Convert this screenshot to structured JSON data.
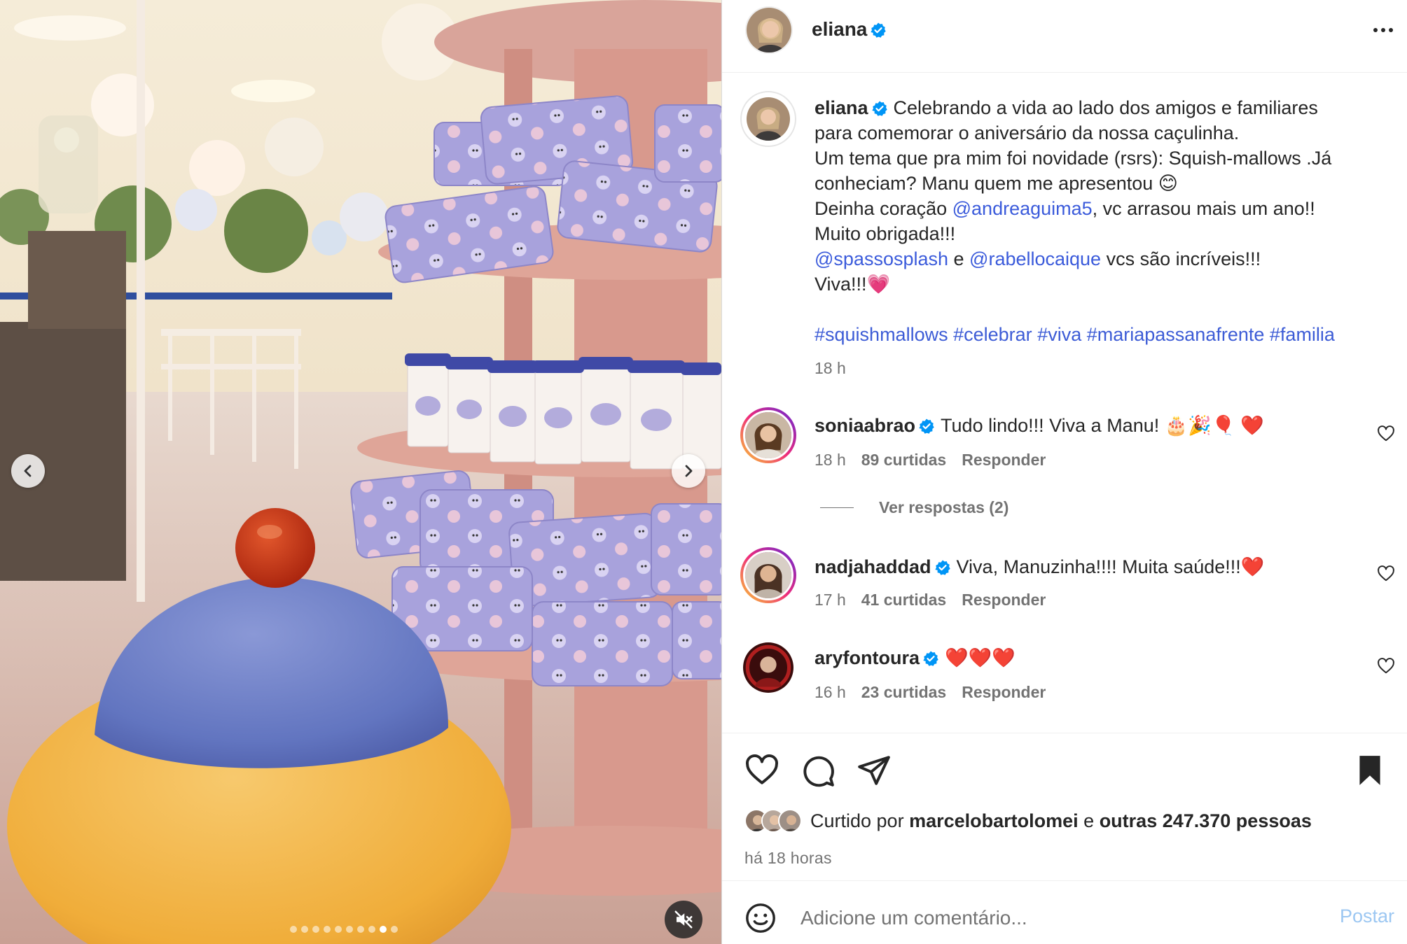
{
  "post": {
    "username": "eliana",
    "verified": true,
    "media": {
      "slide_count": 10,
      "active_slide": 9
    }
  },
  "caption": {
    "username": "eliana",
    "line1": "Celebrando a vida ao lado dos amigos e familiares",
    "line2": "para comemorar o aniversário da nossa caçulinha.",
    "line3": "Um tema que pra mim foi novidade (rsrs): Squish-mallows .Já",
    "line4": "conheciam? Manu quem me apresentou 😊",
    "line5_pre": "Deinha coração ",
    "line5_mention": "@andreaguima5",
    "line5_post": ", vc arrasou mais um ano!!",
    "line6": "Muito obrigada!!!",
    "line7_mention1": "@spassosplash",
    "line7_mid": " e ",
    "line7_mention2": "@rabellocaique",
    "line7_post": " vcs são incríveis!!!",
    "line8": "Viva!!!💗",
    "hashtags": [
      "#squishmallows",
      "#celebrar",
      "#viva",
      "#mariapassanafrente",
      "#familia"
    ],
    "time": "18 h"
  },
  "comments": [
    {
      "username": "soniaabrao",
      "text": "Tudo lindo!!! Viva a Manu! 🎂🎉🎈 ❤️",
      "time": "18 h",
      "likes": "89 curtidas",
      "reply": "Responder"
    },
    {
      "username": "nadjahaddad",
      "text": "Viva, Manuzinha!!!! Muita saúde!!!❤️",
      "time": "17 h",
      "likes": "41 curtidas",
      "reply": "Responder"
    },
    {
      "username": "aryfontoura",
      "text": "❤️❤️❤️",
      "time": "16 h",
      "likes": "23 curtidas",
      "reply": "Responder"
    }
  ],
  "view_replies": "Ver respostas (2)",
  "likes": {
    "prefix": "Curtido por ",
    "user": "marcelobartolomei",
    "mid": " e ",
    "others": "outras 247.370 pessoas"
  },
  "time_ago": "há 18 horas",
  "comment_box": {
    "placeholder": "Adicione um comentário...",
    "post_label": "Postar"
  },
  "icons": [
    "chevron-left-icon",
    "chevron-right-icon",
    "muted-speaker-icon",
    "verified-badge-icon",
    "more-options-icon",
    "heart-icon",
    "comment-icon",
    "share-icon",
    "bookmark-icon",
    "emoji-icon"
  ],
  "colors": {
    "link": "#3d5cd6",
    "verified": "#0095f6",
    "muted": "#737373",
    "post_disabled": "#9cc7f2"
  }
}
